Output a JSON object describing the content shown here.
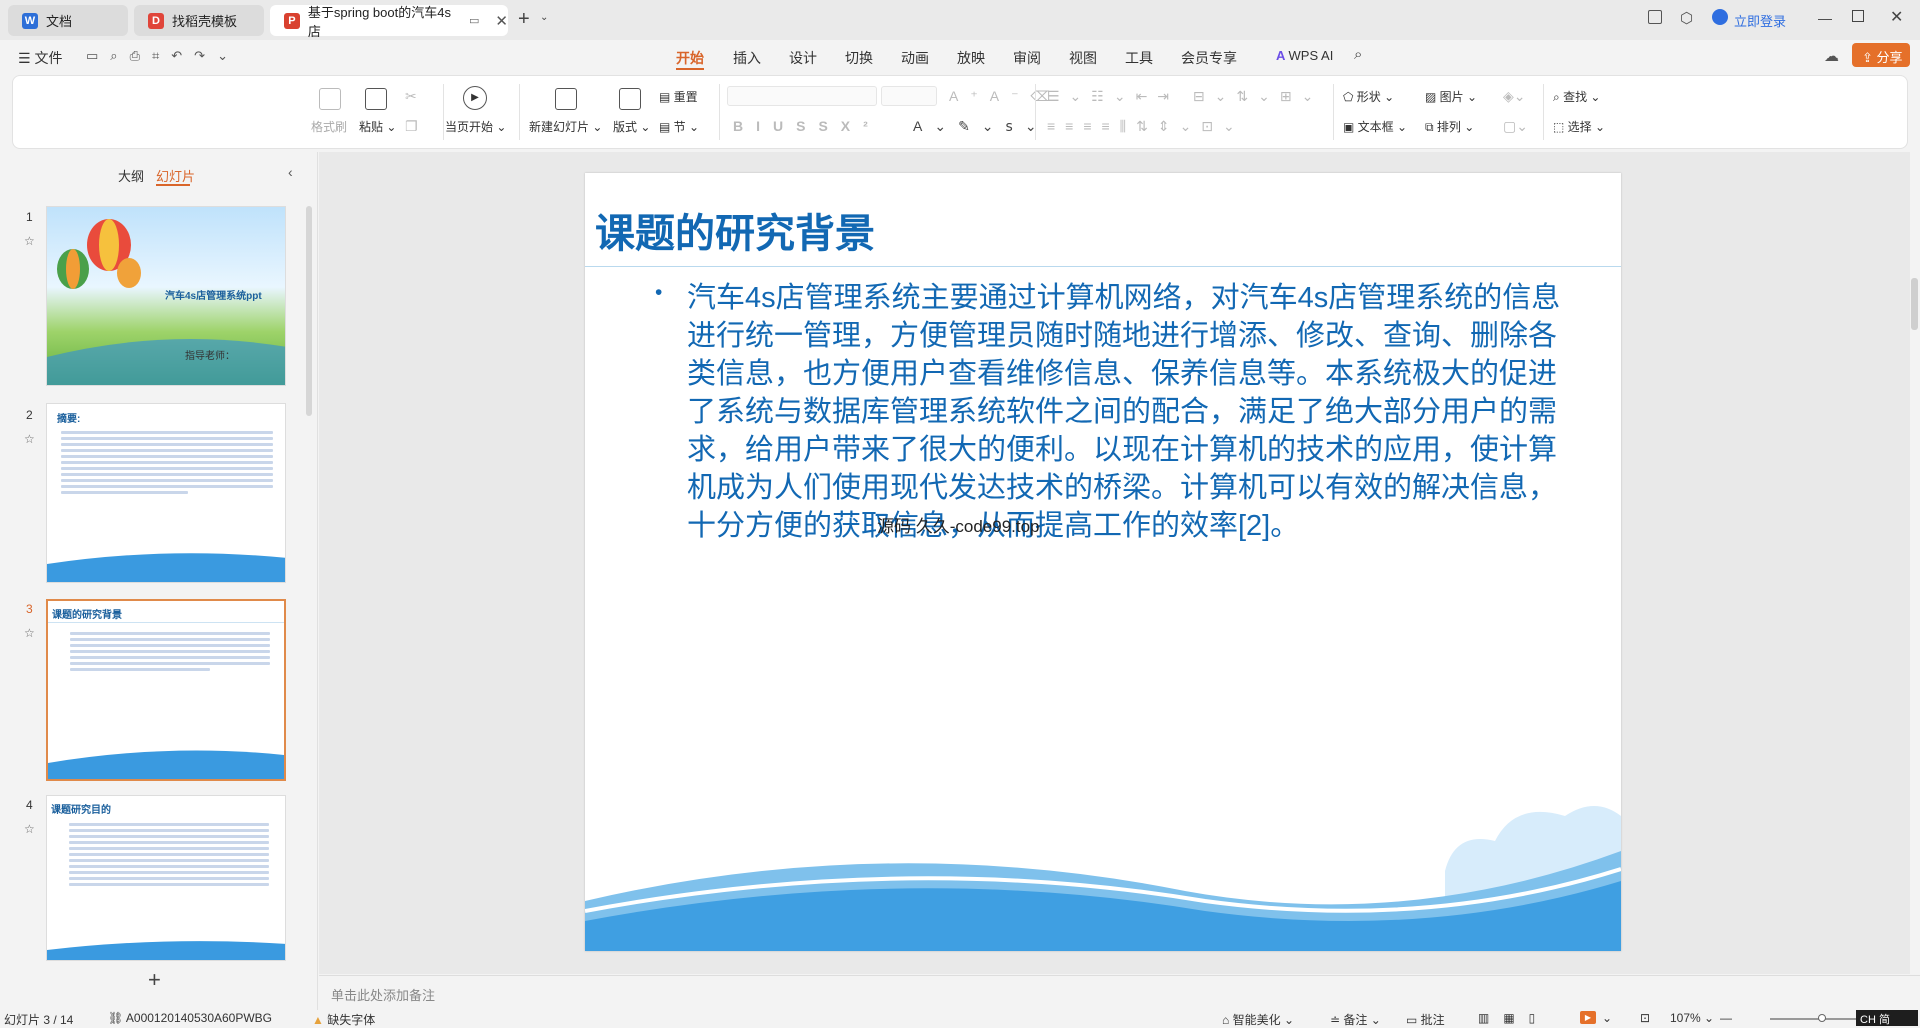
{
  "tabs": [
    {
      "label": "文档",
      "color": "#2d6fd8",
      "icon": "W"
    },
    {
      "label": "找稻壳模板",
      "color": "#e0453a",
      "icon": "D"
    },
    {
      "label": "基于spring boot的汽车4s店",
      "color": "#d9412f",
      "icon": "P"
    }
  ],
  "titlebar": {
    "login": "立即登录"
  },
  "menubar": {
    "file": "文件",
    "items": [
      "开始",
      "插入",
      "设计",
      "切换",
      "动画",
      "放映",
      "审阅",
      "视图",
      "工具",
      "会员专享"
    ],
    "active": "开始",
    "ai": "WPS AI",
    "share": "分享"
  },
  "ribbon": {
    "format_brush": "格式刷",
    "paste": "粘贴",
    "slideshow": "当页开始",
    "new_slide": "新建幻灯片",
    "layout": "版式",
    "reset": "重置",
    "section": "节",
    "shape": "形状",
    "picture": "图片",
    "textbox": "文本框",
    "arrange": "排列",
    "find": "查找",
    "select": "选择"
  },
  "panel": {
    "tab_outline": "大纲",
    "tab_slides": "幻灯片"
  },
  "thumbs": [
    {
      "num": "1",
      "title": "汽车4s店管理系统ppt",
      "teacher": "指导老师："
    },
    {
      "num": "2",
      "title": "摘要:"
    },
    {
      "num": "3",
      "title": "课题的研究背景"
    },
    {
      "num": "4",
      "title": "课题研究目的"
    }
  ],
  "slide": {
    "title": "课题的研究背景",
    "body": "汽车4s店管理系统主要通过计算机网络，对汽车4s店管理系统的信息进行统一管理，方便管理员随时随地进行增添、修改、查询、删除各类信息，也方便用户查看维修信息、保养信息等。本系统极大的促进了系统与数据库管理系统软件之间的配合，满足了绝大部分用户的需求，给用户带来了很大的便利。以现在计算机的技术的应用，使计算机成为人们使用现代发达技术的桥梁。计算机可以有效的解决信息，十分方便的获取信息，从而提高工作的效率[2]。",
    "watermark": "源码 久久-code99.top"
  },
  "notes": {
    "placeholder": "单击此处添加备注"
  },
  "status": {
    "slide_count": "幻灯片 3 / 14",
    "doc_id": "A000120140530A60PWBG",
    "missing_font": "缺失字体",
    "beautify": "智能美化",
    "notes": "备注",
    "comments": "批注",
    "zoom": "107%",
    "ime": "CH 简"
  }
}
